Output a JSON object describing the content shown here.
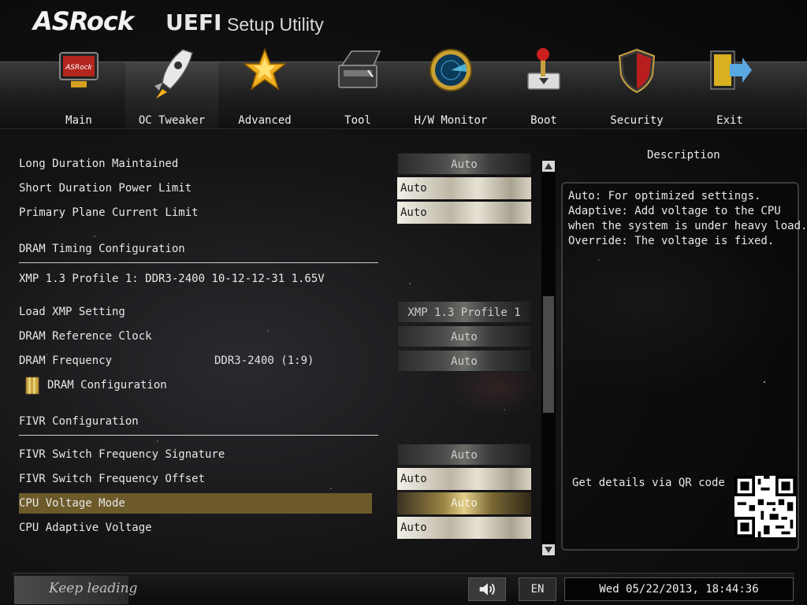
{
  "header": {
    "brand": "ASRock",
    "product": "UEFI",
    "subtitle": "Setup Utility"
  },
  "nav": {
    "active": "OC Tweaker",
    "tabs": [
      {
        "label": "Main",
        "icon": "monitor-icon"
      },
      {
        "label": "OC Tweaker",
        "icon": "rocket-icon"
      },
      {
        "label": "Advanced",
        "icon": "star-icon"
      },
      {
        "label": "Tool",
        "icon": "toolbox-icon"
      },
      {
        "label": "H/W Monitor",
        "icon": "radar-icon"
      },
      {
        "label": "Boot",
        "icon": "joystick-icon"
      },
      {
        "label": "Security",
        "icon": "shield-icon"
      },
      {
        "label": "Exit",
        "icon": "exit-door-icon"
      }
    ]
  },
  "settings": {
    "long_duration_maintained": {
      "label": "Long Duration Maintained",
      "value": "Auto"
    },
    "short_duration_power_limit": {
      "label": "Short Duration Power Limit",
      "value": "Auto"
    },
    "primary_plane_current_limit": {
      "label": "Primary Plane Current Limit",
      "value": "Auto"
    },
    "dram_timing_header": "DRAM Timing Configuration",
    "xmp_info": "XMP 1.3 Profile 1: DDR3-2400 10-12-12-31 1.65V",
    "load_xmp_setting": {
      "label": "Load XMP Setting",
      "value": "XMP 1.3 Profile 1"
    },
    "dram_reference_clock": {
      "label": "DRAM Reference Clock",
      "value": "Auto"
    },
    "dram_frequency": {
      "label": "DRAM Frequency",
      "info": "DDR3-2400 (1:9)",
      "value": "Auto"
    },
    "dram_configuration": "DRAM Configuration",
    "fivr_header": "FIVR Configuration",
    "fivr_switch_frequency_signature": {
      "label": "FIVR Switch Frequency Signature",
      "value": "Auto"
    },
    "fivr_switch_frequency_offset": {
      "label": "FIVR Switch Frequency Offset",
      "value": "Auto"
    },
    "cpu_voltage_mode": {
      "label": "CPU Voltage Mode",
      "value": "Auto"
    },
    "cpu_adaptive_voltage": {
      "label": "CPU Adaptive Voltage",
      "value": "Auto"
    }
  },
  "description": {
    "title": "Description",
    "lines": [
      "Auto: For optimized settings.",
      "Adaptive: Add voltage to the CPU",
      "when the system is under heavy load.",
      "Override: The voltage is fixed."
    ],
    "qr_label": "Get details via QR code"
  },
  "footer": {
    "tagline": "Keep leading",
    "language": "EN",
    "datetime": "Wed 05/22/2013, 18:44:36"
  }
}
